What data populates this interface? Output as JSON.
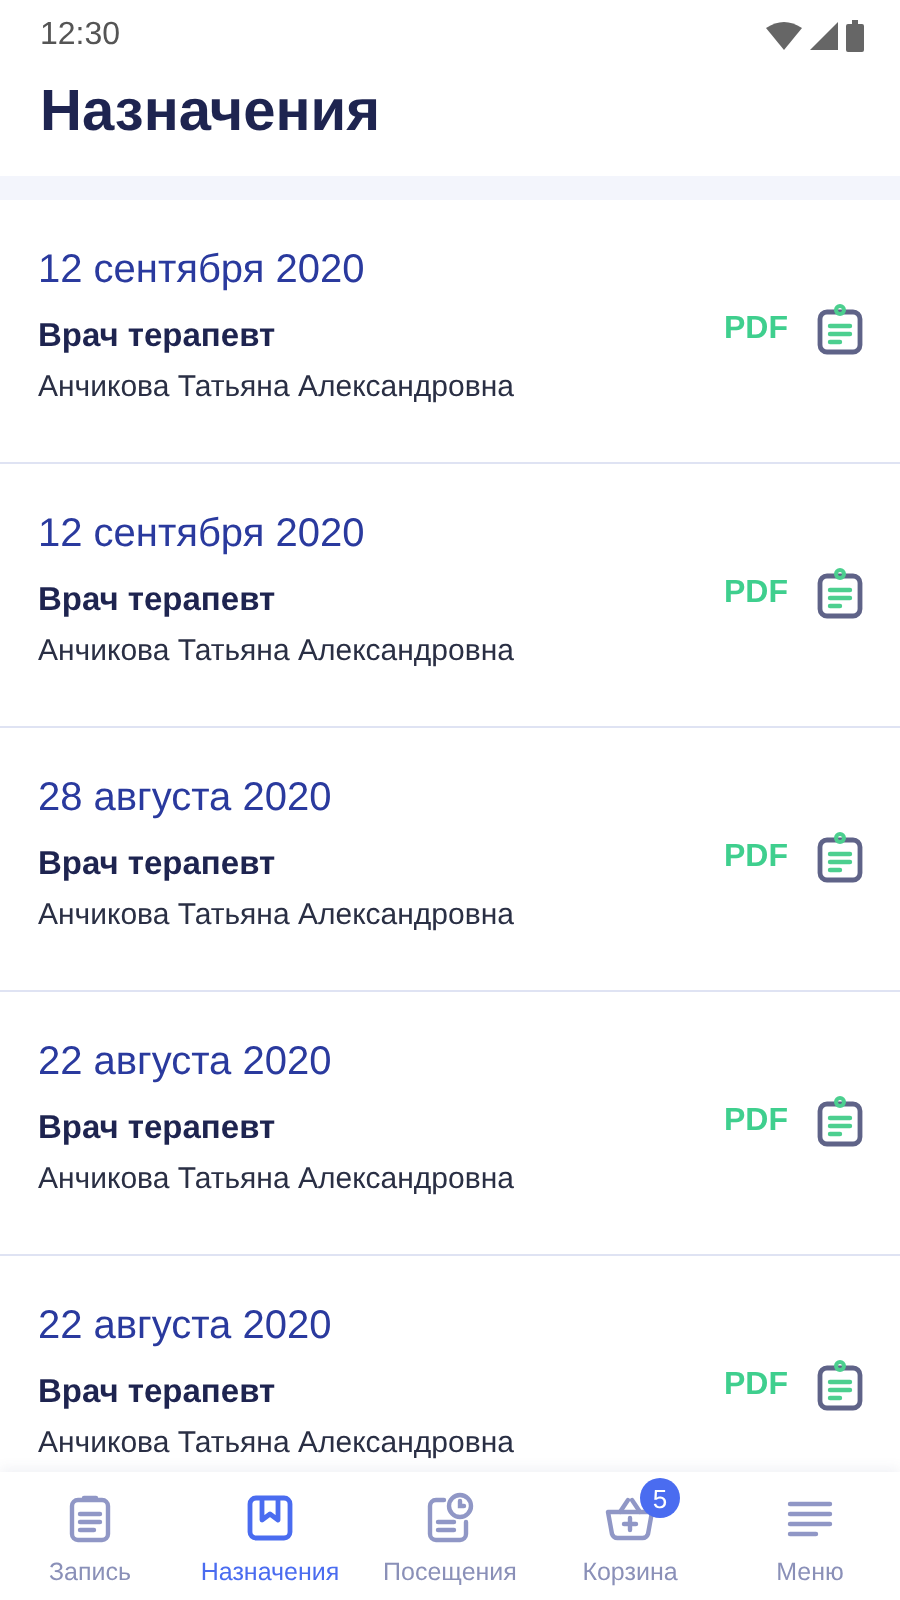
{
  "status_bar": {
    "time": "12:30"
  },
  "header": {
    "title": "Назначения"
  },
  "appointments": [
    {
      "date": "12 сентября 2020",
      "specialty": "Врач терапевт",
      "doctor": "Анчикова Татьяна Александровна",
      "pdf": "PDF"
    },
    {
      "date": "12 сентября 2020",
      "specialty": "Врач терапевт",
      "doctor": "Анчикова Татьяна Александровна",
      "pdf": "PDF"
    },
    {
      "date": "28 августа 2020",
      "specialty": "Врач терапевт",
      "doctor": "Анчикова Татьяна Александровна",
      "pdf": "PDF"
    },
    {
      "date": "22 августа 2020",
      "specialty": "Врач терапевт",
      "doctor": "Анчикова Татьяна Александровна",
      "pdf": "PDF"
    },
    {
      "date": "22 августа 2020",
      "specialty": "Врач терапевт",
      "doctor": "Анчикова Татьяна Александровна",
      "pdf": "PDF"
    }
  ],
  "bottom_nav": [
    {
      "kind": "record",
      "label": "Запись",
      "selected": false
    },
    {
      "kind": "prescriptions",
      "label": "Назначения",
      "selected": true
    },
    {
      "kind": "visits",
      "label": "Посещения",
      "selected": false
    },
    {
      "kind": "cart",
      "label": "Корзина",
      "selected": false,
      "badge": "5"
    },
    {
      "kind": "menu",
      "label": "Меню",
      "selected": false
    }
  ]
}
